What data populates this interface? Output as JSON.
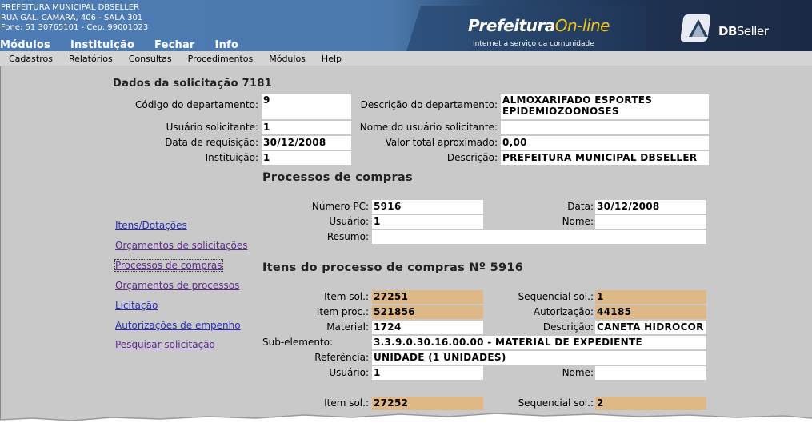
{
  "header": {
    "inst_line1": "PREFEITURA MUNICIPAL DBSELLER",
    "inst_line2": "RUA GAL. CAMARA, 406 - SALA 301",
    "inst_line3": "Fone: 51 30765101  -  Cep: 99001023",
    "top_menu": [
      "Módulos",
      "Instituição",
      "Fechar",
      "Info"
    ],
    "logo_prefeitura": "Prefeitura",
    "logo_online": "On-line",
    "logo_tagline": "Internet a serviço da comunidade",
    "logo_dbseller_db": "DB",
    "logo_dbseller_rest": "Seller"
  },
  "menubar": [
    "Cadastros",
    "Relatórios",
    "Consultas",
    "Procedimentos",
    "Módulos",
    "Help"
  ],
  "solicitacao": {
    "title": "Dados da solicitação 7181",
    "cod_dep_label": "Código do departamento:",
    "cod_dep": "9",
    "desc_dep_label": "Descrição do departamento:",
    "desc_dep_line1": "ALMOXARIFADO ESPORTES",
    "desc_dep_line2": "EPIDEMIOZOONOSES",
    "usuario_label": "Usuário solicitante:",
    "usuario": "1",
    "nome_usuario_label": "Nome do usuário solicitante:",
    "nome_usuario": "",
    "data_req_label": "Data de requisição:",
    "data_req": "30/12/2008",
    "valor_label": "Valor total aproximado:",
    "valor": "0,00",
    "instituicao_label": "Instituição:",
    "instituicao": "1",
    "descricao_label": "Descrição:",
    "descricao": "PREFEITURA MUNICIPAL DBSELLER"
  },
  "sidebar_links": [
    {
      "label": "Itens/Dotações",
      "color": "blue"
    },
    {
      "label": "Orçamentos de solicitações",
      "color": "purple"
    },
    {
      "label": "Processos de compras",
      "color": "purple"
    },
    {
      "label": "Orçamentos de processos",
      "color": "purple"
    },
    {
      "label": "Licitação",
      "color": "blue"
    },
    {
      "label": "Autorizações de empenho",
      "color": "blue"
    },
    {
      "label": "Pesquisar solicitação",
      "color": "purple"
    }
  ],
  "processos": {
    "title": "Processos de compras",
    "numero_label": "Número PC:",
    "numero": "5916",
    "data_label": "Data:",
    "data": "30/12/2008",
    "usuario_label": "Usuário:",
    "usuario": "1",
    "nome_label": "Nome:",
    "nome": "",
    "resumo_label": "Resumo:",
    "resumo": ""
  },
  "itens": {
    "title": "Itens do processo de compras Nº 5916",
    "item_sol_label": "Item sol.:",
    "item_sol": "27251",
    "seq_sol_label": "Sequencial sol.:",
    "seq_sol": "1",
    "item_proc_label": "Item proc.:",
    "item_proc": "521856",
    "autorizacao_label": "Autorização:",
    "autorizacao": "44185",
    "material_label": "Material:",
    "material": "1724",
    "descricao_label": "Descrição:",
    "descricao": "CANETA HIDROCOR",
    "subelemento_label": "Sub-elemento:",
    "subelemento": "3.3.9.0.30.16.00.00 - MATERIAL DE EXPEDIENTE",
    "referencia_label": "Referência:",
    "referencia": "UNIDADE (1 UNIDADES)",
    "usuario_label": "Usuário:",
    "usuario": "1",
    "nome_label": "Nome:",
    "nome": "",
    "item_sol2_label": "Item sol.:",
    "item_sol2": "27252",
    "seq_sol2_label": "Sequencial sol.:",
    "seq_sol2": "2"
  },
  "colors": {
    "tan_field": "#deb887",
    "link_blue": "#2a2ab8",
    "link_purple": "#5c2c8c",
    "background": "#c9c9c9"
  }
}
